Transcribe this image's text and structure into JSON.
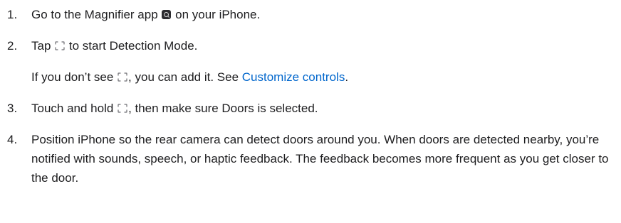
{
  "steps": [
    {
      "number": "1.",
      "before": "Go to the Magnifier app",
      "after": " on your iPhone.",
      "icon": "magnifier-app-icon"
    },
    {
      "number": "2.",
      "before": "Tap",
      "after": " to start Detection Mode.",
      "icon": "detection-mode-icon",
      "sub": {
        "before": "If you don’t see",
        "middle": ", you can add it. See ",
        "link": "Customize controls",
        "after": "."
      }
    },
    {
      "number": "3.",
      "before": "Touch and hold",
      "after": ", then make sure Doors is selected.",
      "icon": "detection-mode-icon"
    },
    {
      "number": "4.",
      "text": "Position iPhone so the rear camera can detect doors around you. When doors are detected nearby, you’re notified with sounds, speech, or haptic feedback. The feedback becomes more frequent as you get closer to the door."
    }
  ],
  "colors": {
    "text": "#1d1d1f",
    "link": "#0066cc",
    "icon": "#2b2b2f"
  }
}
